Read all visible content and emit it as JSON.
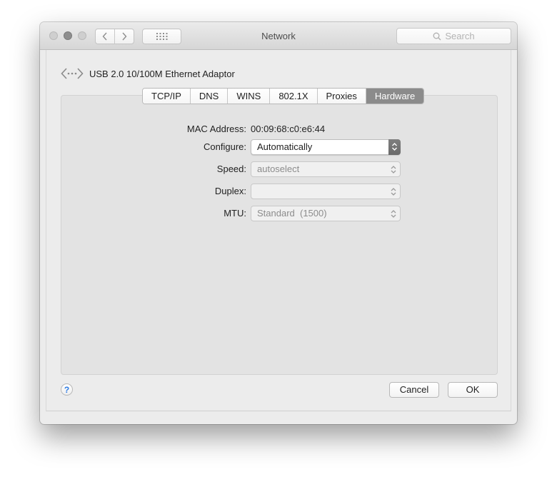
{
  "window": {
    "title": "Network"
  },
  "search": {
    "placeholder": "Search"
  },
  "adaptor": {
    "name": "USB 2.0 10/100M Ethernet Adaptor",
    "icon": "ethernet-arrows-icon"
  },
  "tabs": [
    {
      "label": "TCP/IP"
    },
    {
      "label": "DNS"
    },
    {
      "label": "WINS"
    },
    {
      "label": "802.1X"
    },
    {
      "label": "Proxies"
    },
    {
      "label": "Hardware",
      "selected": true
    }
  ],
  "hardware": {
    "mac_label": "MAC Address:",
    "mac_value": "00:09:68:c0:e6:44",
    "configure_label": "Configure:",
    "configure_value": "Automatically",
    "speed_label": "Speed:",
    "speed_value": "autoselect",
    "duplex_label": "Duplex:",
    "duplex_value": "",
    "mtu_label": "MTU:",
    "mtu_value": "Standard  (1500)"
  },
  "footer": {
    "help_glyph": "?",
    "cancel_label": "Cancel",
    "ok_label": "OK"
  },
  "colors": {
    "selected_tab": "#8b8b8b",
    "help_accent": "#2d7be3",
    "window_bg": "#ececec"
  }
}
